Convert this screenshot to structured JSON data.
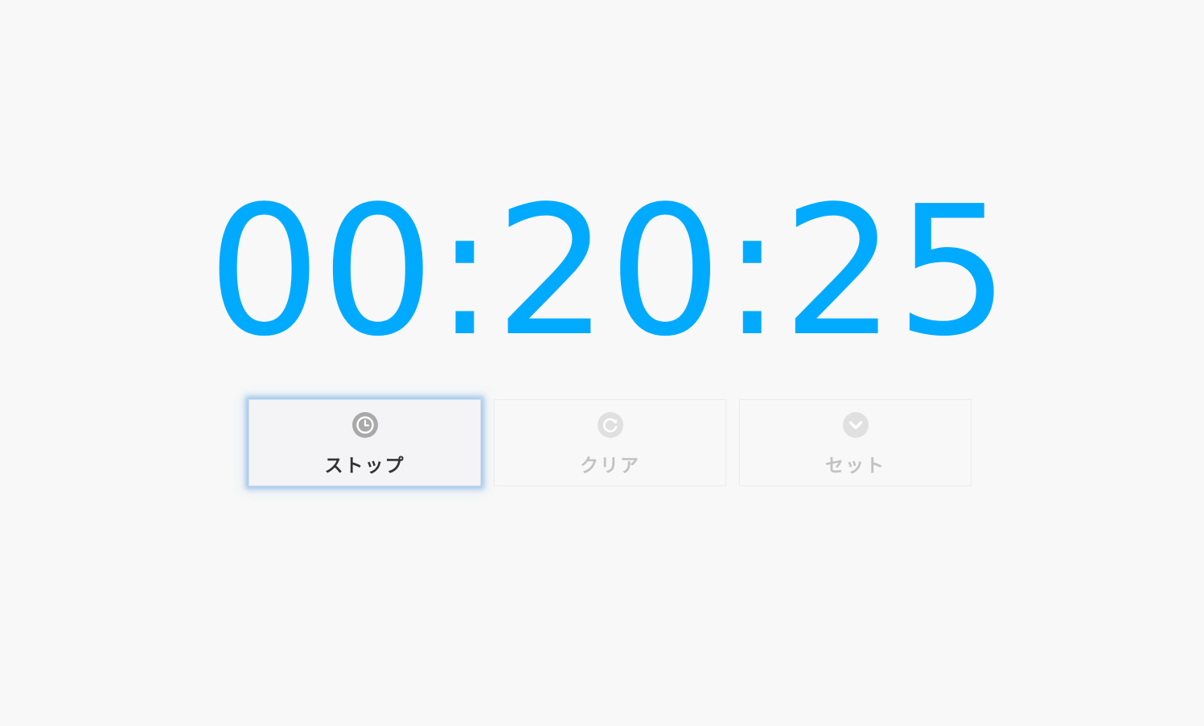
{
  "timer": {
    "display": "00:20:25"
  },
  "buttons": {
    "stop": {
      "label": "ストップ",
      "icon": "clock-icon",
      "state": "active"
    },
    "clear": {
      "label": "クリア",
      "icon": "refresh-icon",
      "state": "disabled"
    },
    "set": {
      "label": "セット",
      "icon": "chevron-down-icon",
      "state": "disabled"
    }
  },
  "colors": {
    "time": "#00aaff",
    "background": "#f8f8f8",
    "active_label": "#333333",
    "disabled_label": "#c2c2c2",
    "active_icon": "#a9a9a9",
    "disabled_icon": "#e0e0e0",
    "focus_glow": "#5096dc"
  }
}
